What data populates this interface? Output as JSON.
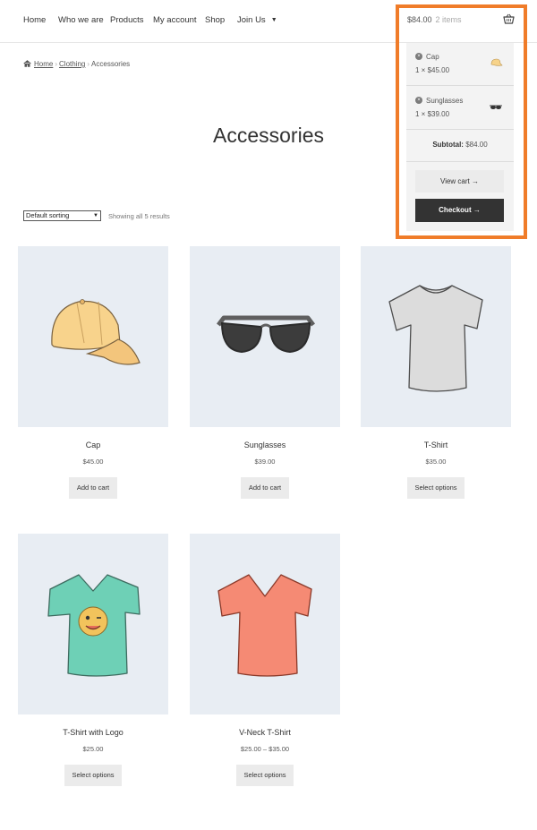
{
  "nav": {
    "items": [
      "Home",
      "Who we are",
      "Products",
      "My account",
      "Shop",
      "Join Us"
    ],
    "caret_icon": "chevron-down-icon"
  },
  "cart": {
    "total": "$84.00",
    "count": "2 items",
    "icon": "shopping-basket-icon",
    "items": [
      {
        "name": "Cap",
        "qty": "1 × $45.00",
        "remove_icon": "remove-circle-icon"
      },
      {
        "name": "Sunglasses",
        "qty": "1 × $39.00",
        "remove_icon": "remove-circle-icon"
      }
    ],
    "subtotal_label": "Subtotal:",
    "subtotal_value": "$84.00",
    "view_cart": "View cart →",
    "checkout": "Checkout →",
    "highlight_color": "#f07c29"
  },
  "breadcrumb": {
    "home": "Home",
    "clothing": "Clothing",
    "current": "Accessories",
    "separator": "›"
  },
  "page": {
    "title": "Accessories"
  },
  "shop": {
    "sort_value": "Default sorting",
    "result_count": "Showing all 5 results"
  },
  "products": [
    {
      "title": "Cap",
      "price": "$45.00",
      "button": "Add to cart",
      "image": "cap"
    },
    {
      "title": "Sunglasses",
      "price": "$39.00",
      "button": "Add to cart",
      "image": "sunglasses"
    },
    {
      "title": "T-Shirt",
      "price": "$35.00",
      "button": "Select options",
      "image": "t-shirt"
    },
    {
      "title": "T-Shirt with Logo",
      "price": "$25.00",
      "button": "Select options",
      "image": "t-shirt-logo"
    },
    {
      "title": "V-Neck T-Shirt",
      "price": "$25.00 – $35.00",
      "button": "Select options",
      "image": "v-neck-t-shirt"
    }
  ],
  "colors": {
    "checkout_bg": "#333333",
    "product_bg": "#e8edf3",
    "button_bg": "#ebebeb"
  }
}
